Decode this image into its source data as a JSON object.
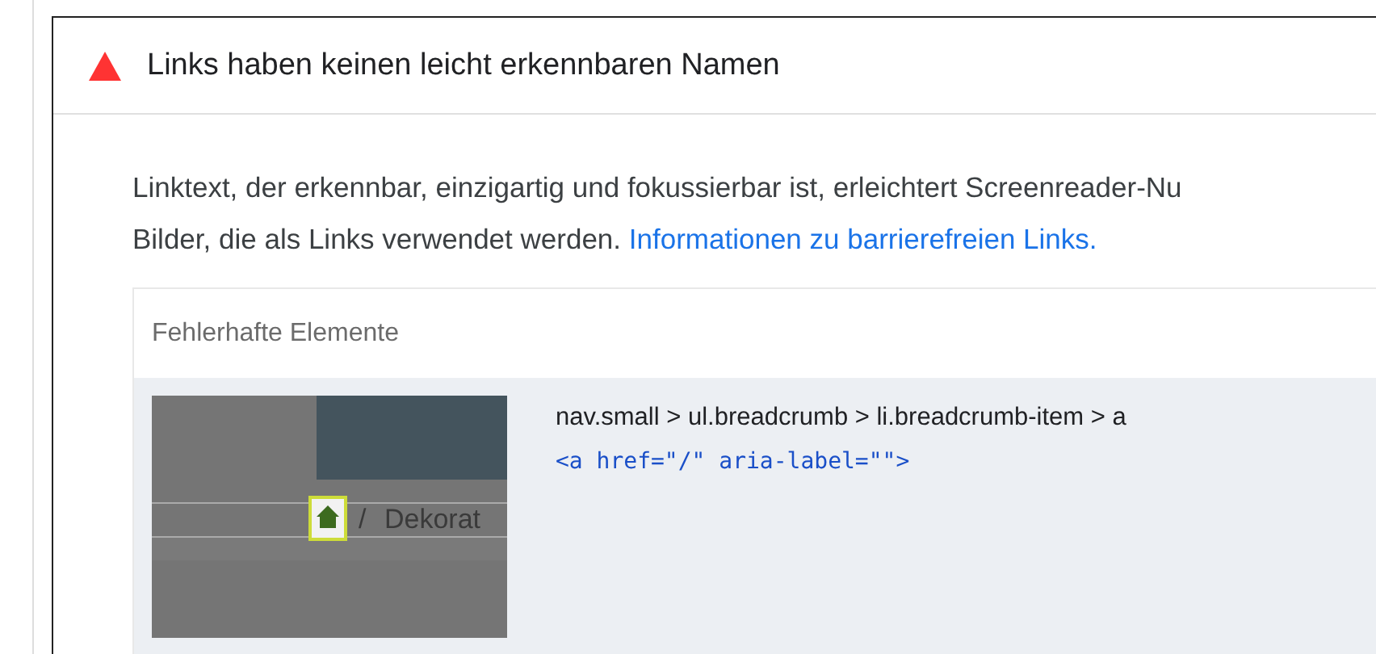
{
  "audit": {
    "title": "Links haben keinen leicht erkennbaren Namen",
    "description_lines": [
      {
        "text": "Linktext, der erkennbar, einzigartig und fokussierbar ist, erleichtert Screenreader-Nu"
      },
      {
        "text": "Bilder, die als Links verwendet werden.",
        "link": "Informationen zu barrierefreien Links."
      }
    ]
  },
  "failing_elements": {
    "heading": "Fehlerhafte Elemente",
    "items": [
      {
        "thumbnail": {
          "separator": "/",
          "crumb": "Dekorat"
        },
        "selector": "nav.small > ul.breadcrumb > li.breadcrumb-item > a",
        "snippet": "<a href=\"/\" aria-label=\"\">"
      }
    ]
  }
}
